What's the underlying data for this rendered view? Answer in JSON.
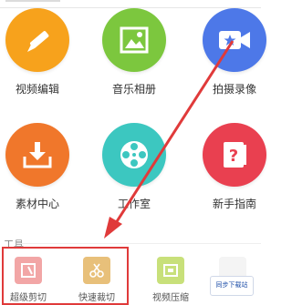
{
  "tiles": [
    {
      "label": "视频编辑",
      "icon": "pencil-icon",
      "color": "#f7a21c"
    },
    {
      "label": "音乐相册",
      "icon": "picture-icon",
      "color": "#7cc73e"
    },
    {
      "label": "拍摄录像",
      "icon": "video-camera-icon",
      "color": "#4d78e8"
    },
    {
      "label": "素材中心",
      "icon": "download-tray-icon",
      "color": "#f0772b"
    },
    {
      "label": "工作室",
      "icon": "film-reel-icon",
      "color": "#3cc7c0"
    },
    {
      "label": "新手指南",
      "icon": "help-book-icon",
      "color": "#e94050"
    }
  ],
  "tools": {
    "section_label": "工具",
    "items": [
      {
        "label": "超级剪切",
        "icon": "clip-icon",
        "color": "#f2a6a6"
      },
      {
        "label": "快速裁切",
        "icon": "scissors-icon",
        "color": "#e8c07a"
      },
      {
        "label": "视频压缩",
        "icon": "compress-icon",
        "color": "#c8e07a"
      },
      {
        "label": "",
        "icon": "tool-icon",
        "color": "#ffffff"
      }
    ]
  },
  "watermark": {
    "text": "同步下载站"
  },
  "annotation": {
    "color": "#e03a3a"
  }
}
